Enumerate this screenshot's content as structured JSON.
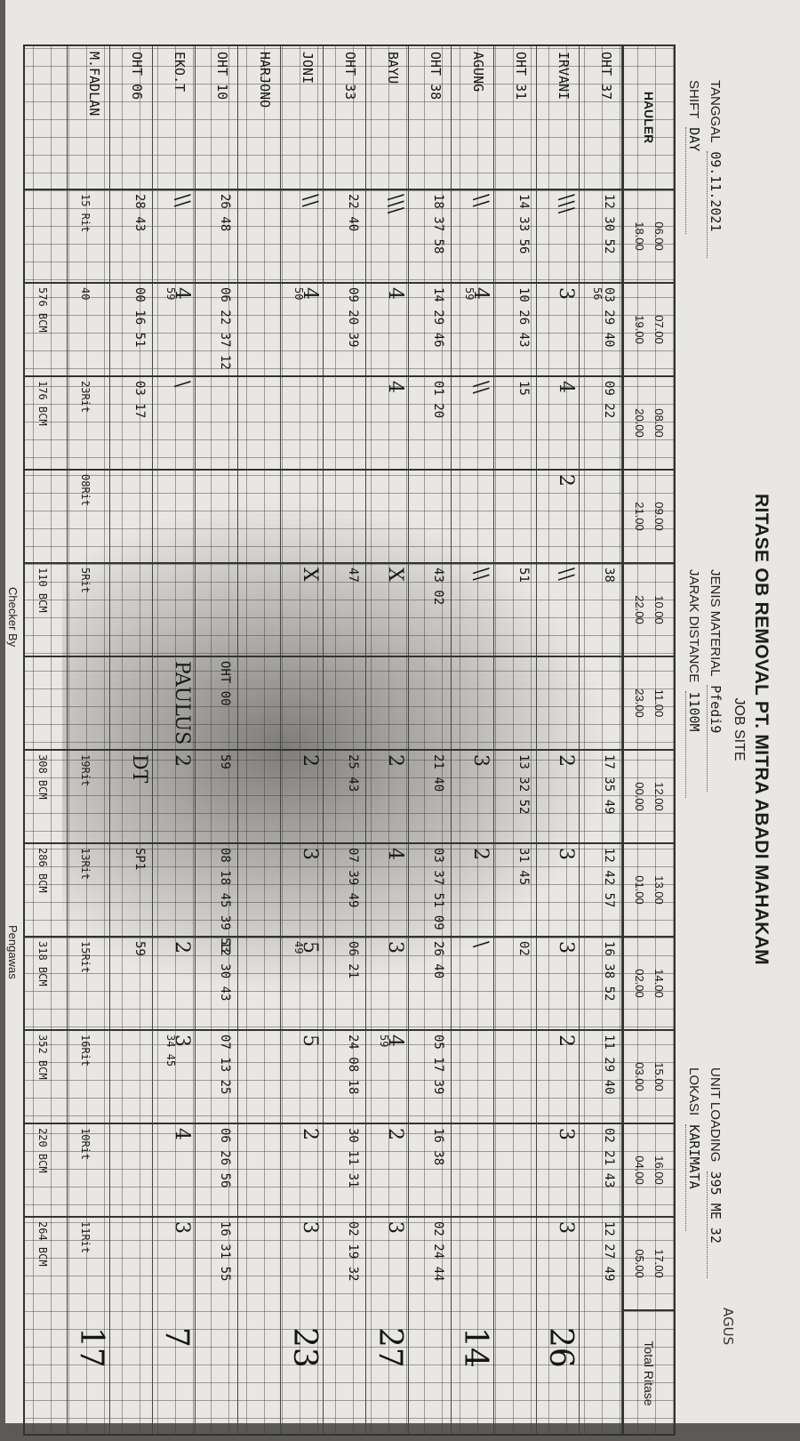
{
  "header": {
    "title": "RITASE OB REMOVAL PT. MITRA ABADI MAHAKAM",
    "job_site": "JOB SITE",
    "operator": "AGUS"
  },
  "meta": {
    "tanggal_label": "TANGGAL",
    "tanggal_value": "09.11.2021",
    "shift_label": "SHIFT",
    "shift_value": "DAY",
    "jenis_label": "JENIS MATERIAL",
    "jenis_value": "Pfedi9",
    "jarak_label": "JARAK DISTANCE",
    "jarak_value": "1100M",
    "unit_label": "UNIT LOADING",
    "unit_value": "395 ME 32",
    "lokasi_label": "LOKASI",
    "lokasi_value": "KARIMATA"
  },
  "table": {
    "hauler_label": "HAULER",
    "total_label": "Total Ritase",
    "hours": [
      {
        "day": "06.00",
        "night": "18.00"
      },
      {
        "day": "07.00",
        "night": "19.00"
      },
      {
        "day": "08.00",
        "night": "20.00"
      },
      {
        "day": "09.00",
        "night": "21.00"
      },
      {
        "day": "10.00",
        "night": "22.00"
      },
      {
        "day": "11.00",
        "night": "23.00"
      },
      {
        "day": "12.00",
        "night": "00.00"
      },
      {
        "day": "13.00",
        "night": "01.00"
      },
      {
        "day": "14.00",
        "night": "02.00"
      },
      {
        "day": "15.00",
        "night": "03.00"
      },
      {
        "day": "16.00",
        "night": "04.00"
      },
      {
        "day": "17.00",
        "night": "05.00"
      }
    ],
    "rows": [
      {
        "name": "OHT 37",
        "c0": "12 30 52",
        "c1": "03 29 40",
        "c2": "09 22",
        "c4": "38",
        "c6": "17 35 49",
        "c7": "12 42 57",
        "c8": "16 38 52",
        "c9": "11 29 40",
        "c10": "02 21 43",
        "c11": "12 27 49",
        "sub1": "56"
      },
      {
        "name": "IRVANI",
        "t0": "\\\\\\",
        "t1": "3",
        "t2": "4",
        "t3": "2",
        "t4": "\\\\",
        "t6": "2",
        "t7": "3",
        "t8": "3",
        "t9": "2",
        "t10": "3",
        "t11": "3",
        "total": "26"
      },
      {
        "name": "OHT 31",
        "c0": "14 33 56",
        "c1": "10 26 43",
        "c2": "15",
        "c4": "51",
        "c6": "13 32 52",
        "c7": "31 45",
        "c8": "02"
      },
      {
        "name": "AGUNG",
        "t0": "\\\\",
        "t1": "4",
        "t2": "\\\\",
        "t4": "\\\\",
        "t6": "3",
        "t7": "2",
        "t8": "\\",
        "sub1": "59",
        "total": "14"
      },
      {
        "name": "OHT 38",
        "c0": "18 37 58",
        "c1": "14 29 46",
        "c2": "01 20",
        "c4": "43 02",
        "c6": "21 40",
        "c7": "03 37 51 09",
        "c8": "26 40",
        "c9": "05 17 39",
        "c10": "16 38",
        "c11": "02 24 44"
      },
      {
        "name": "BAYU",
        "t0": "\\\\\\",
        "t1": "4",
        "t2": "4",
        "t4": "X",
        "t6": "2",
        "t7": "4",
        "t8": "3",
        "t9": "4",
        "t10": "2",
        "t11": "3",
        "sub9": "59",
        "total": "27"
      },
      {
        "name": "OHT 33",
        "c0": "22 40",
        "c1": "09 20 39",
        "c4": "47",
        "c6": "25 43",
        "c7": "07 39 49",
        "c8": "06 21",
        "c9": "24 08 18",
        "c10": "30 11 31",
        "c11": "02 19 32"
      },
      {
        "name": "JONI",
        "t0": "\\\\",
        "t1": "4",
        "t4": "X",
        "t6": "2",
        "t7": "3",
        "t8": "5",
        "t9": "5",
        "t10": "2",
        "t11": "3",
        "sub1": "50",
        "sub8": "49",
        "total": "23"
      },
      {
        "name": "HARJONO",
        "t0": "",
        "t1": ""
      },
      {
        "name": "OHT 10",
        "c0": "26 48",
        "c1": "06 22 37 12",
        "c5": "OHT 00",
        "c6": "59",
        "c7": "08 18 45 39 53",
        "c8": "12 30 43",
        "c9": "07 13 25",
        "c10": "06 26 56",
        "c11": "16 31 55"
      },
      {
        "name": "EKO.T",
        "t0": "\\\\",
        "t1": "4",
        "t2": "\\",
        "t5": "PAULUS",
        "t6": "2",
        "t8": "2",
        "t9": "3",
        "t10": "4",
        "t11": "3",
        "sub1": "59",
        "sub9": "34 45",
        "total": "7"
      },
      {
        "name": "OHT 06",
        "c0": "28 43",
        "c1": "00 16 51",
        "c2": "03 17",
        "t6": "DT",
        "c7": "SP1",
        "c8": "59"
      },
      {
        "name": "M.FADLAN",
        "t0": "",
        "sub0": "15 Rit",
        "sub1": "40",
        "sub2": "23Rit",
        "sub3": "08Rit",
        "sub4": "5Rit",
        "sub6": "19Rit",
        "sub7": "13Rit",
        "sub8": "15Rit",
        "sub9": "16Rit",
        "sub10": "10Rit",
        "sub11": "11Rit",
        "total": "17"
      },
      {
        "name": "",
        "sub1": "576 BCM",
        "sub2": "176 BCM",
        "sub4": "110 BCM",
        "sub6": "308 BCM",
        "sub7": "286 BCM",
        "sub8": "318 BCM",
        "sub9": "352 BCM",
        "sub10": "220 BCM",
        "sub11": "264 BCM"
      }
    ]
  },
  "footer": {
    "checker": "Checker By",
    "pengawas": "Pengawas"
  }
}
